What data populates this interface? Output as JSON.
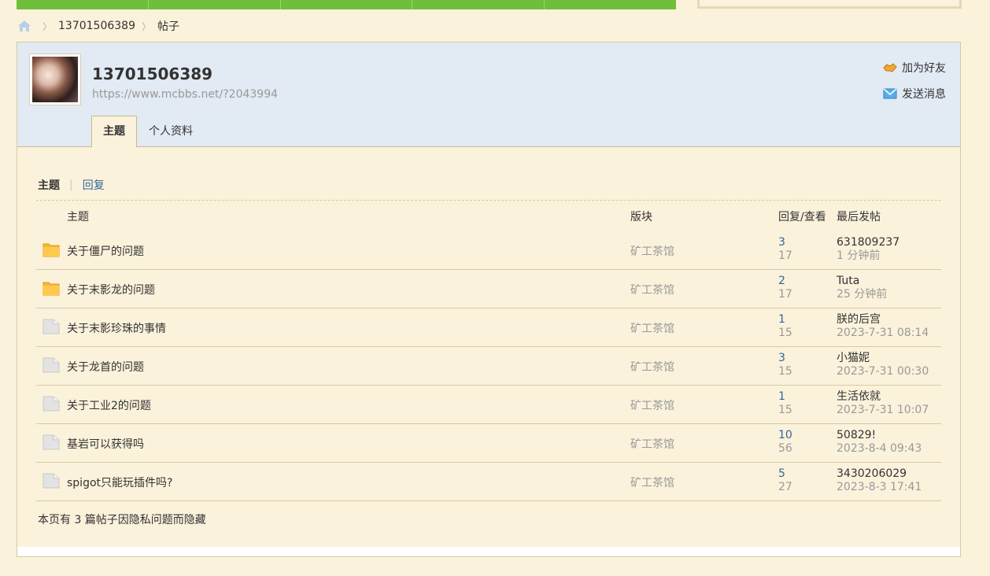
{
  "breadcrumb": {
    "user": "13701506389",
    "section": "帖子"
  },
  "profile": {
    "username": "13701506389",
    "url": "https://www.mcbbs.net/?2043994",
    "add_friend": "加为好友",
    "send_message": "发送消息"
  },
  "tabs": {
    "topics": "主题",
    "profile_info": "个人资料"
  },
  "subtabs": {
    "topics": "主题",
    "replies": "回复"
  },
  "table": {
    "headers": {
      "subject": "主题",
      "forum": "版块",
      "reply_view": "回复/查看",
      "last_post": "最后发帖"
    },
    "rows": [
      {
        "subject": "关于僵尸的问题",
        "forum": "矿工茶馆",
        "replies": "3",
        "views": "17",
        "last_user": "631809237",
        "last_time": "1 分钟前",
        "icon": "folder-new-icon"
      },
      {
        "subject": "关于末影龙的问题",
        "forum": "矿工茶馆",
        "replies": "2",
        "views": "17",
        "last_user": "Tuta",
        "last_time": "25 分钟前",
        "icon": "folder-new-icon"
      },
      {
        "subject": "关于末影珍珠的事情",
        "forum": "矿工茶馆",
        "replies": "1",
        "views": "15",
        "last_user": "朕的后宫",
        "last_time": "2023-7-31 08:14",
        "icon": "folder-icon"
      },
      {
        "subject": "关于龙首的问题",
        "forum": "矿工茶馆",
        "replies": "3",
        "views": "15",
        "last_user": "小猫妮",
        "last_time": "2023-7-31 00:30",
        "icon": "folder-icon"
      },
      {
        "subject": "关于工业2的问题",
        "forum": "矿工茶馆",
        "replies": "1",
        "views": "15",
        "last_user": "生活依就",
        "last_time": "2023-7-31 10:07",
        "icon": "folder-icon"
      },
      {
        "subject": "基岩可以获得吗",
        "forum": "矿工茶馆",
        "replies": "10",
        "views": "56",
        "last_user": "50829!",
        "last_time": "2023-8-4 09:43",
        "icon": "folder-icon"
      },
      {
        "subject": "spigot只能玩插件吗?",
        "forum": "矿工茶馆",
        "replies": "5",
        "views": "27",
        "last_user": "3430206029",
        "last_time": "2023-8-3 17:41",
        "icon": "folder-icon"
      }
    ]
  },
  "note": "本页有 3 篇帖子因隐私问题而隐藏",
  "colors": {
    "background": "#FBF2DB",
    "header_bg": "#E2EAF3",
    "nav_green": "#6FBF3C",
    "link_blue": "#336699"
  }
}
